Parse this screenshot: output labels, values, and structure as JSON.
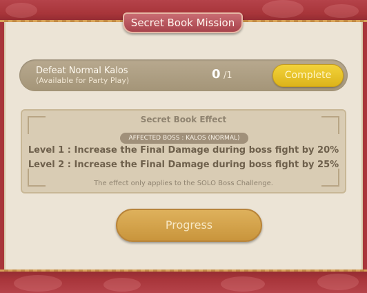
{
  "window": {
    "title": "Secret Book Mission"
  },
  "mission": {
    "name": "Defeat Normal Kalos",
    "note": "(Available for Party Play)",
    "progress_current": "0",
    "progress_total": "/1",
    "complete_label": "Complete"
  },
  "effect": {
    "title": "Secret Book Effect",
    "boss_badge": "AFFECTED BOSS :  KALOS (NORMAL)",
    "levels": [
      "Level 1 : Increase the Final Damage during boss fight by 20%",
      "Level 2 : Increase the Final Damage during boss fight by 25%"
    ],
    "note": "The effect only applies to the SOLO Boss Challenge."
  },
  "footer": {
    "progress_label": "Progress"
  },
  "colors": {
    "frame": "#a8353a",
    "panel": "#ece4d6",
    "complete_button": "#e8c42a",
    "progress_button": "#d4a24c"
  }
}
